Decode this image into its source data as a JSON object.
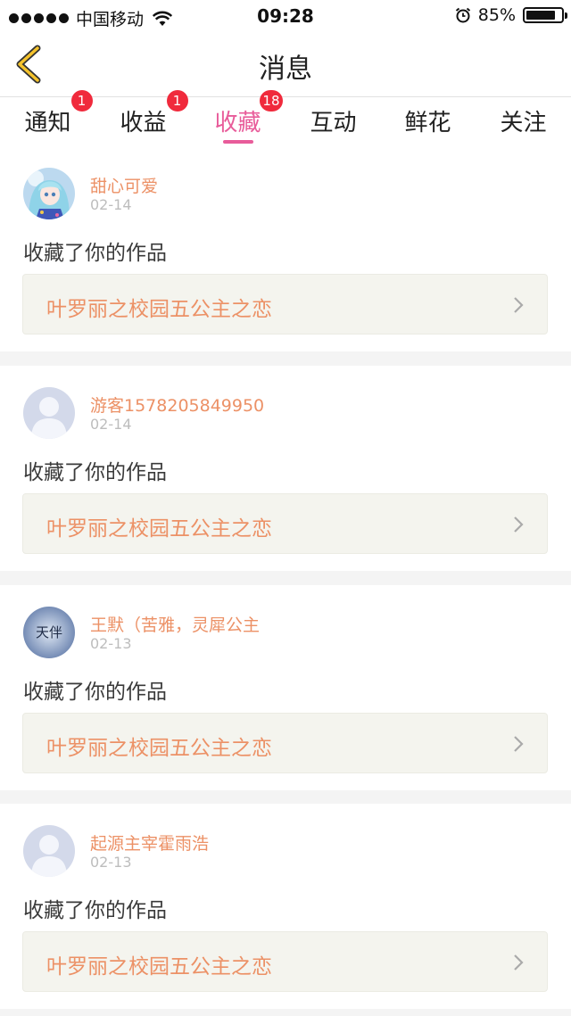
{
  "status_bar": {
    "carrier": "中国移动",
    "time": "09:28",
    "battery": "85%",
    "battery_level": 0.85,
    "icons": [
      "signal-dots-icon",
      "wifi-icon",
      "alarm-icon",
      "battery-icon"
    ]
  },
  "header": {
    "title": "消息",
    "back_icon": "chevron-left-icon",
    "accent_color": "#f5c32c"
  },
  "tabs": [
    {
      "label": "通知",
      "badge": "1"
    },
    {
      "label": "收益",
      "badge": "1"
    },
    {
      "label": "收藏",
      "badge": "18",
      "active": true
    },
    {
      "label": "互动",
      "badge": ""
    },
    {
      "label": "鲜花",
      "badge": ""
    },
    {
      "label": "关注",
      "badge": ""
    }
  ],
  "colors": {
    "active_tab": "#e85c9a",
    "badge": "#f02a3c",
    "username": "#ec9166",
    "work_title": "#ec9166"
  },
  "messages": [
    {
      "user": "甜心可爱",
      "date": "02-14",
      "text": "收藏了你的作品",
      "work": "叶罗丽之校园五公主之恋",
      "avatar": "anime-girl-avatar"
    },
    {
      "user": "游客1578205849950",
      "date": "02-14",
      "text": "收藏了你的作品",
      "work": "叶罗丽之校园五公主之恋",
      "avatar": "default-user-avatar"
    },
    {
      "user": "王默（苦雅，灵犀公主",
      "date": "02-13",
      "text": "收藏了你的作品",
      "work": "叶罗丽之校园五公主之恋",
      "avatar": "calligraphy-avatar",
      "avatar_text": "天伴"
    },
    {
      "user": "起源主宰霍雨浩",
      "date": "02-13",
      "text": "收藏了你的作品",
      "work": "叶罗丽之校园五公主之恋",
      "avatar": "default-user-avatar"
    }
  ]
}
